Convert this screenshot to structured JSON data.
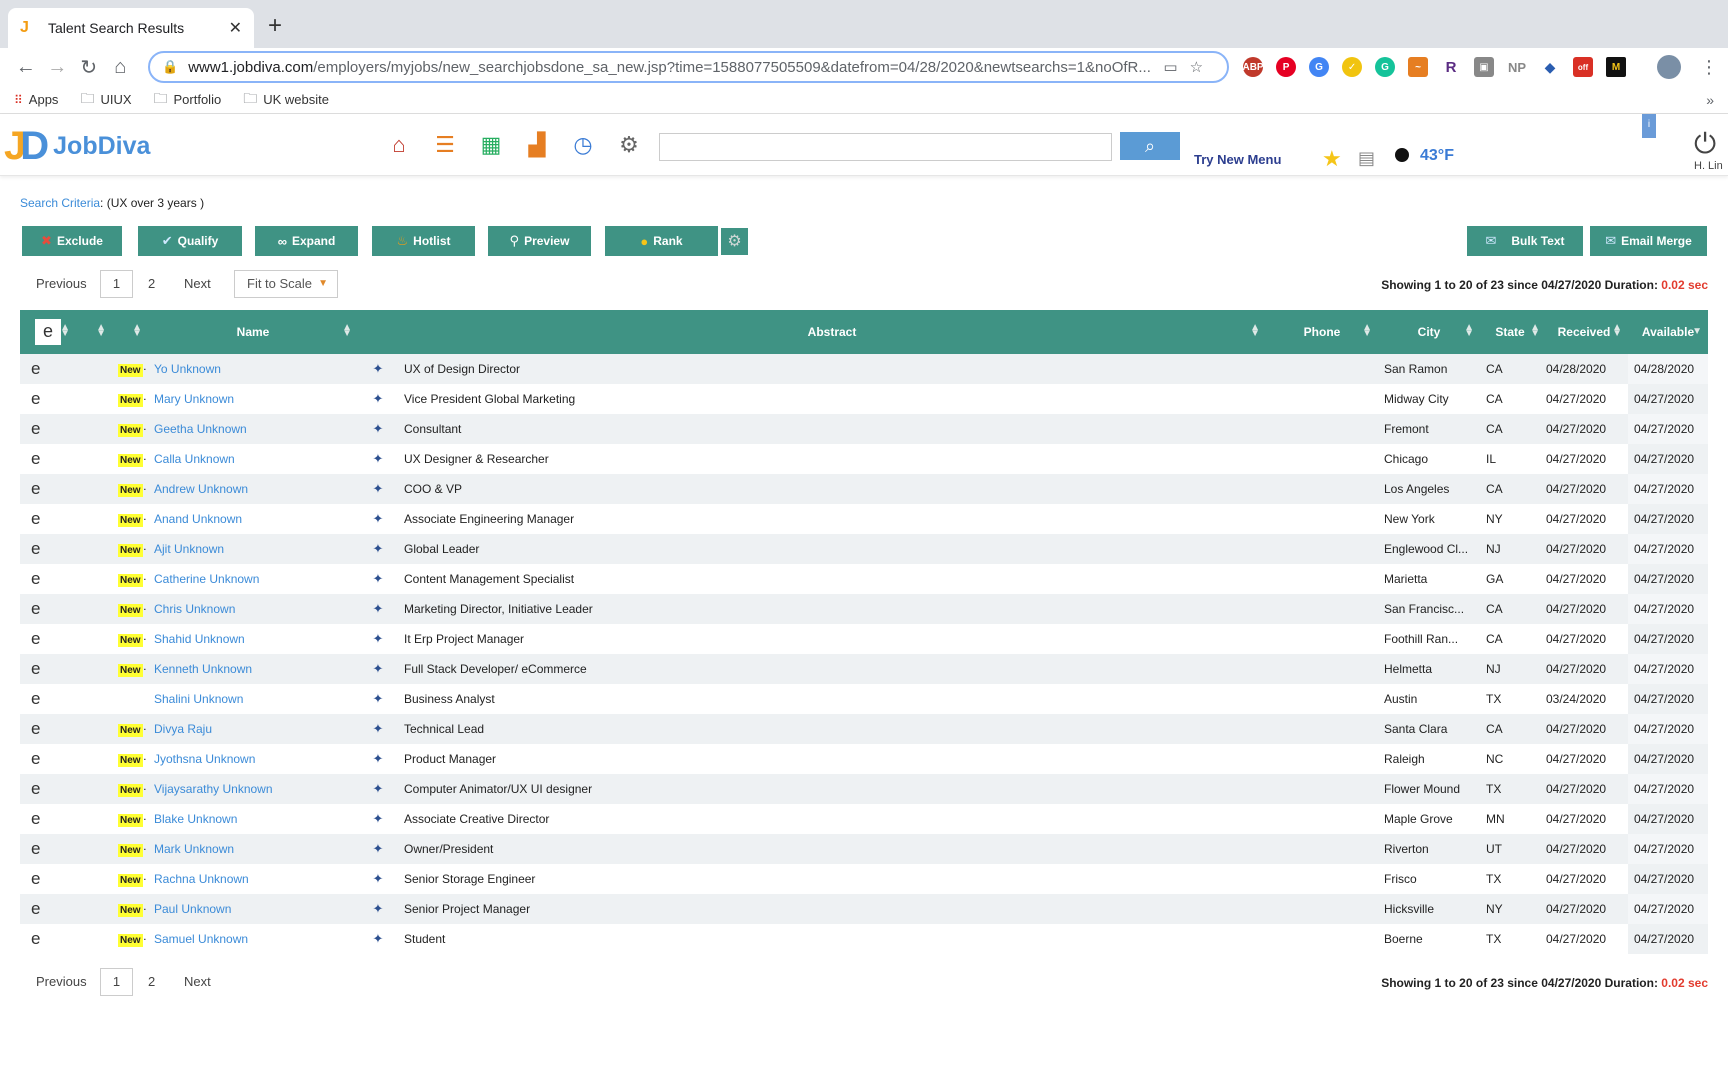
{
  "browser": {
    "tab_title": "Talent Search Results",
    "url_host": "www1.jobdiva.com",
    "url_path": "/employers/myjobs/new_searchjobsdone_sa_new.jsp?time=1588077505509&datefrom=04/28/2020&newtsearchs=1&noOfR...",
    "bookmarks": [
      "Apps",
      "UIUX",
      "Portfolio",
      "UK website"
    ],
    "extensions": [
      "ABP",
      "P",
      "G",
      "✓",
      "G",
      "~",
      "R",
      "▣",
      "NP",
      "◆",
      "off",
      "M"
    ]
  },
  "header": {
    "logo_mark": "JD",
    "logo_text": "JobDiva",
    "try_menu": "Try New Menu",
    "temperature": "43°F",
    "user": "H. Lin"
  },
  "criteria": {
    "label": "Search Criteria",
    "value": ": (UX over 3 years )"
  },
  "toolbar": {
    "exclude": "Exclude",
    "qualify": "Qualify",
    "expand": "Expand",
    "hotlist": "Hotlist",
    "preview": "Preview",
    "rank": "Rank",
    "bulk_text": "Bulk Text",
    "email_merge": "Email Merge"
  },
  "pager": {
    "previous": "Previous",
    "page1": "1",
    "page2": "2",
    "next": "Next",
    "fit": "Fit to Scale",
    "showing": "Showing 1 to 20 of 23 since 04/27/2020 Duration: ",
    "duration": "0.02 sec"
  },
  "table": {
    "headers": {
      "select": "e",
      "name": "Name",
      "abstract": "Abstract",
      "phone": "Phone",
      "city": "City",
      "state": "State",
      "received": "Received",
      "available": "Available"
    },
    "new_label": "New",
    "e_label": "e",
    "rows": [
      {
        "new": true,
        "name": "Yo Unknown",
        "abstract": "UX of Design Director",
        "city": "San Ramon",
        "state": "CA",
        "received": "04/28/2020",
        "available": "04/28/2020"
      },
      {
        "new": true,
        "name": "Mary Unknown",
        "abstract": "Vice President Global Marketing",
        "city": "Midway City",
        "state": "CA",
        "received": "04/27/2020",
        "available": "04/27/2020"
      },
      {
        "new": true,
        "name": "Geetha Unknown",
        "abstract": "Consultant",
        "city": "Fremont",
        "state": "CA",
        "received": "04/27/2020",
        "available": "04/27/2020"
      },
      {
        "new": true,
        "name": "Calla Unknown",
        "abstract": "UX Designer & Researcher",
        "city": "Chicago",
        "state": "IL",
        "received": "04/27/2020",
        "available": "04/27/2020"
      },
      {
        "new": true,
        "name": "Andrew Unknown",
        "abstract": "COO & VP",
        "city": "Los Angeles",
        "state": "CA",
        "received": "04/27/2020",
        "available": "04/27/2020"
      },
      {
        "new": true,
        "name": "Anand Unknown",
        "abstract": "Associate Engineering Manager",
        "city": "New York",
        "state": "NY",
        "received": "04/27/2020",
        "available": "04/27/2020"
      },
      {
        "new": true,
        "name": "Ajit Unknown",
        "abstract": "Global Leader",
        "city": "Englewood Cl...",
        "state": "NJ",
        "received": "04/27/2020",
        "available": "04/27/2020"
      },
      {
        "new": true,
        "name": "Catherine Unknown",
        "abstract": "Content Management Specialist",
        "city": "Marietta",
        "state": "GA",
        "received": "04/27/2020",
        "available": "04/27/2020"
      },
      {
        "new": true,
        "name": "Chris Unknown",
        "abstract": "Marketing Director, Initiative Leader",
        "city": "San Francisc...",
        "state": "CA",
        "received": "04/27/2020",
        "available": "04/27/2020"
      },
      {
        "new": true,
        "name": "Shahid Unknown",
        "abstract": "It Erp Project Manager",
        "city": "Foothill Ran...",
        "state": "CA",
        "received": "04/27/2020",
        "available": "04/27/2020"
      },
      {
        "new": true,
        "name": "Kenneth Unknown",
        "abstract": "Full Stack Developer/ eCommerce",
        "city": "Helmetta",
        "state": "NJ",
        "received": "04/27/2020",
        "available": "04/27/2020"
      },
      {
        "new": false,
        "name": "Shalini Unknown",
        "abstract": "Business Analyst",
        "city": "Austin",
        "state": "TX",
        "received": "03/24/2020",
        "available": "04/27/2020"
      },
      {
        "new": true,
        "name": "Divya Raju",
        "abstract": "Technical Lead",
        "city": "Santa Clara",
        "state": "CA",
        "received": "04/27/2020",
        "available": "04/27/2020"
      },
      {
        "new": true,
        "name": "Jyothsna Unknown",
        "abstract": "Product Manager",
        "city": "Raleigh",
        "state": "NC",
        "received": "04/27/2020",
        "available": "04/27/2020"
      },
      {
        "new": true,
        "name": "Vijaysarathy Unknown",
        "abstract": "Computer Animator/UX UI designer",
        "city": "Flower Mound",
        "state": "TX",
        "received": "04/27/2020",
        "available": "04/27/2020"
      },
      {
        "new": true,
        "name": "Blake Unknown",
        "abstract": "Associate Creative Director",
        "city": "Maple Grove",
        "state": "MN",
        "received": "04/27/2020",
        "available": "04/27/2020"
      },
      {
        "new": true,
        "name": "Mark Unknown",
        "abstract": "Owner/President",
        "city": "Riverton",
        "state": "UT",
        "received": "04/27/2020",
        "available": "04/27/2020"
      },
      {
        "new": true,
        "name": "Rachna Unknown",
        "abstract": "Senior Storage Engineer",
        "city": "Frisco",
        "state": "TX",
        "received": "04/27/2020",
        "available": "04/27/2020"
      },
      {
        "new": true,
        "name": "Paul Unknown",
        "abstract": "Senior Project Manager",
        "city": "Hicksville",
        "state": "NY",
        "received": "04/27/2020",
        "available": "04/27/2020"
      },
      {
        "new": true,
        "name": "Samuel Unknown",
        "abstract": "Student",
        "city": "Boerne",
        "state": "TX",
        "received": "04/27/2020",
        "available": "04/27/2020"
      }
    ]
  }
}
